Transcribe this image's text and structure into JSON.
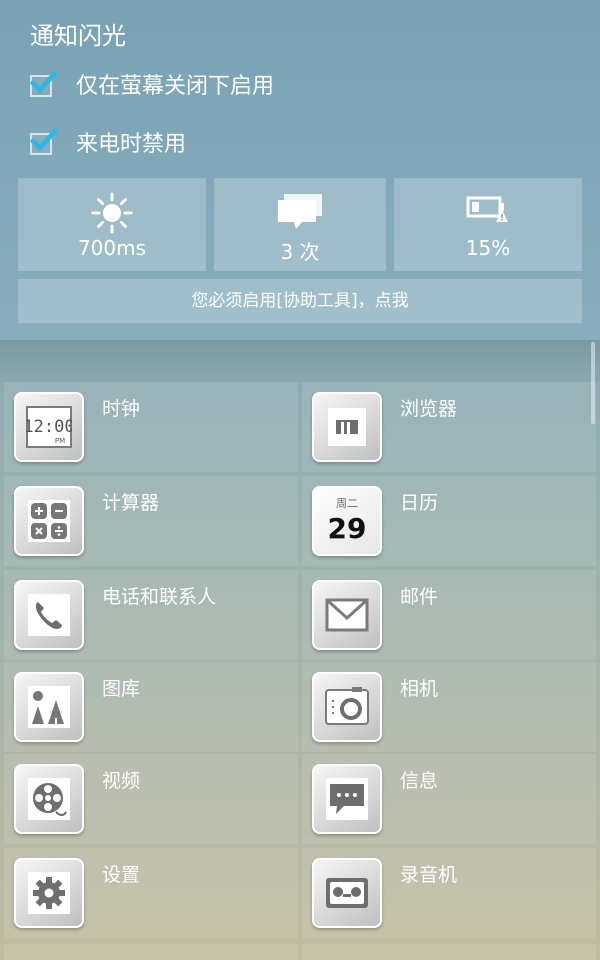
{
  "header": {
    "title": "通知闪光",
    "options": [
      {
        "label": "仅在萤幕关闭下启用",
        "checked": true
      },
      {
        "label": "来电时禁用",
        "checked": true
      }
    ],
    "stats": [
      {
        "icon": "sun-icon",
        "value": "700ms"
      },
      {
        "icon": "message-stack-icon",
        "value": "3 次"
      },
      {
        "icon": "battery-warning-icon",
        "value": "15%"
      }
    ],
    "banner": "您必须启用[协助工具]，点我"
  },
  "apps": [
    {
      "label": "时钟",
      "icon": "clock-icon"
    },
    {
      "label": "浏览器",
      "icon": "browser-icon"
    },
    {
      "label": "计算器",
      "icon": "calculator-icon"
    },
    {
      "label": "日历",
      "icon": "calendar-icon",
      "calendar_day": "29",
      "calendar_week": "周二"
    },
    {
      "label": "电话和联系人",
      "icon": "phone-icon"
    },
    {
      "label": "邮件",
      "icon": "mail-icon"
    },
    {
      "label": "图库",
      "icon": "gallery-icon"
    },
    {
      "label": "相机",
      "icon": "camera-icon"
    },
    {
      "label": "视频",
      "icon": "video-icon"
    },
    {
      "label": "信息",
      "icon": "message-icon"
    },
    {
      "label": "设置",
      "icon": "settings-icon"
    },
    {
      "label": "录音机",
      "icon": "recorder-icon"
    }
  ],
  "clock_icon_text": "12:00",
  "clock_icon_sub": "PM",
  "colors": {
    "accent_check": "#33b5e5",
    "text": "#ffffff"
  }
}
